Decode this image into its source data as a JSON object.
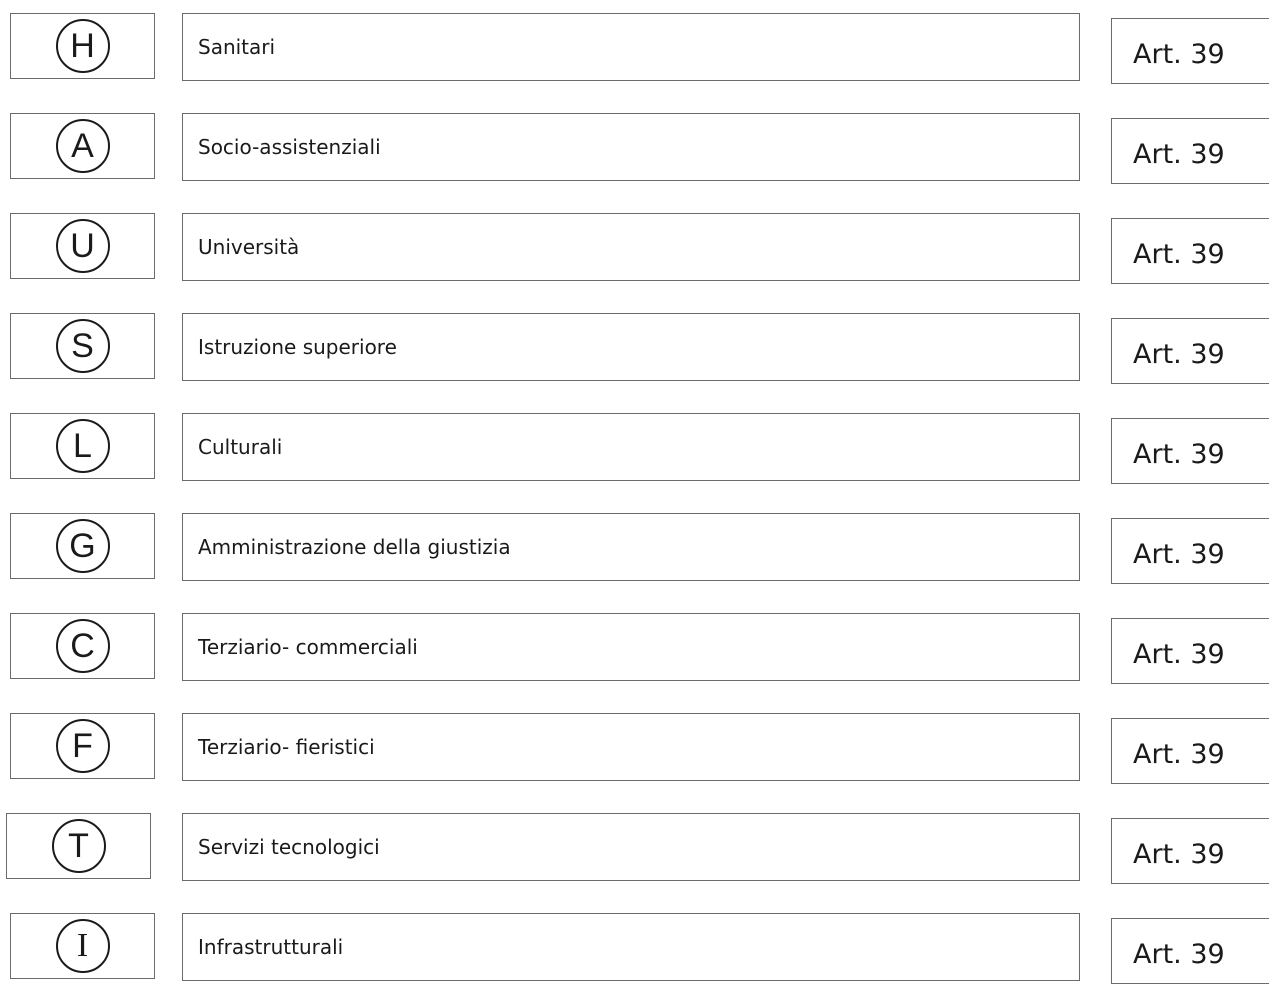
{
  "rows": [
    {
      "symbol": "H",
      "label": "Sanitari",
      "article": "Art. 39"
    },
    {
      "symbol": "A",
      "label": "Socio-assistenziali",
      "article": "Art. 39"
    },
    {
      "symbol": "U",
      "label": "Università",
      "article": "Art. 39"
    },
    {
      "symbol": "S",
      "label": "Istruzione superiore",
      "article": "Art. 39"
    },
    {
      "symbol": "L",
      "label": "Culturali",
      "article": "Art. 39"
    },
    {
      "symbol": "G",
      "label": "Amministrazione della giustizia",
      "article": "Art. 39"
    },
    {
      "symbol": "C",
      "label": "Terziario- commerciali",
      "article": "Art. 39"
    },
    {
      "symbol": "F",
      "label": "Terziario- fieristici",
      "article": "Art. 39"
    },
    {
      "symbol": "T",
      "label": "Servizi tecnologici",
      "article": "Art. 39"
    },
    {
      "symbol": "I",
      "label": "Infrastrutturali",
      "article": "Art. 39"
    }
  ]
}
